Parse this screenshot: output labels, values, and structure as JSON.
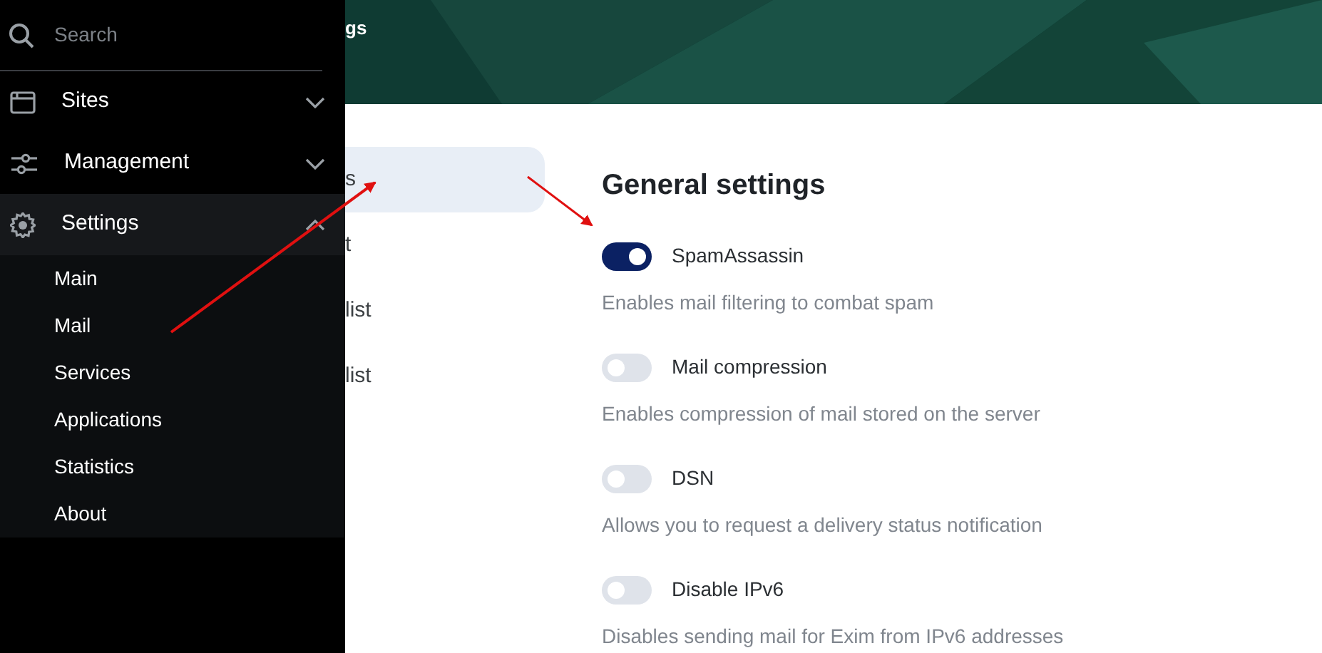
{
  "header": {
    "title": "gs"
  },
  "sidebar": {
    "search": {
      "placeholder": "Search"
    },
    "items": [
      {
        "label": "Sites",
        "expanded": false,
        "selected": false
      },
      {
        "label": "Management",
        "expanded": false,
        "selected": false
      },
      {
        "label": "Settings",
        "expanded": true,
        "selected": true,
        "children": [
          {
            "label": "Main"
          },
          {
            "label": "Mail"
          },
          {
            "label": "Services"
          },
          {
            "label": "Applications"
          },
          {
            "label": "Statistics"
          },
          {
            "label": "About"
          }
        ]
      }
    ]
  },
  "submenu": [
    {
      "label": "s",
      "selected": true
    },
    {
      "label": "t",
      "selected": false
    },
    {
      "label": "list",
      "selected": false
    },
    {
      "label": "list",
      "selected": false
    }
  ],
  "section": {
    "title": "General settings",
    "settings": [
      {
        "label": "SpamAssassin",
        "on": true,
        "description": "Enables mail filtering to combat spam"
      },
      {
        "label": "Mail compression",
        "on": false,
        "description": "Enables compression of mail stored on the server"
      },
      {
        "label": "DSN",
        "on": false,
        "description": "Allows you to request a delivery status notification"
      },
      {
        "label": "Disable IPv6",
        "on": false,
        "description": "Disables sending mail for Exim from IPv6 addresses"
      }
    ]
  }
}
